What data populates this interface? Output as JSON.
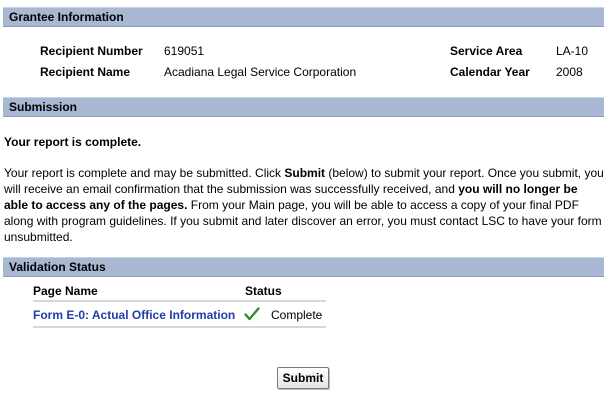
{
  "grantee": {
    "header": "Grantee Information",
    "recipient_number_label": "Recipient Number",
    "recipient_number_value": "619051",
    "recipient_name_label": "Recipient Name",
    "recipient_name_value": "Acadiana Legal Service Corporation",
    "service_area_label": "Service Area",
    "service_area_value": "LA-10",
    "calendar_year_label": "Calendar Year",
    "calendar_year_value": "2008"
  },
  "submission": {
    "header": "Submission",
    "complete_heading": "Your report is complete.",
    "para": {
      "p1": "Your report is complete and may be submitted. Click ",
      "p2": "Submit",
      "p3": " (below) to submit your report. Once you submit, you will receive an email confirmation that the submission was successfully received, and ",
      "p4": "you will no longer be able to access any of the pages.",
      "p5": " From your Main page, you will be able to access a copy of your final PDF along with program guidelines. If you submit and later discover an error, you must contact LSC to have your form unsubmitted."
    }
  },
  "validation": {
    "header": "Validation Status",
    "col_page_name": "Page Name",
    "col_status": "Status",
    "rows": [
      {
        "page_name": "Form E-0: Actual Office Information",
        "status": "Complete",
        "icon": "check-icon"
      }
    ]
  },
  "actions": {
    "submit_label": "Submit"
  },
  "colors": {
    "section_bar": "#a9b8d2",
    "link": "#1f3fa8",
    "check": "#2e8b2e"
  }
}
